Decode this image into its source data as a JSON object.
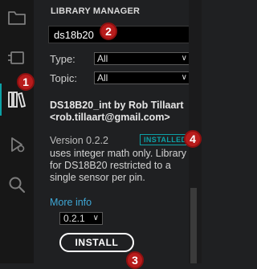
{
  "activity_bar": {
    "items": [
      {
        "name": "folder-icon"
      },
      {
        "name": "board-icon"
      },
      {
        "name": "library-icon",
        "active": true
      },
      {
        "name": "debug-icon"
      },
      {
        "name": "search-icon"
      }
    ]
  },
  "library_manager": {
    "title": "LIBRARY MANAGER",
    "search_value": "ds18b20",
    "filters": [
      {
        "label": "Type:",
        "value": "All"
      },
      {
        "label": "Topic:",
        "value": "All"
      }
    ],
    "result": {
      "name_line": "DS18B20_int by Rob Tillaart <rob.tillaart@gmail.com>",
      "version": "Version 0.2.2",
      "installed_badge": "INSTALLED",
      "description": "uses integer math only. Library for DS18B20 restricted to a single sensor per pin.",
      "more_info": "More info",
      "selected_version": "0.2.1",
      "install_label": "INSTALL"
    }
  },
  "callouts": [
    "1",
    "2",
    "3",
    "4"
  ],
  "colors": {
    "accent": "#0ca1a6",
    "link": "#3fa8d6",
    "callout": "#b81c1c"
  }
}
